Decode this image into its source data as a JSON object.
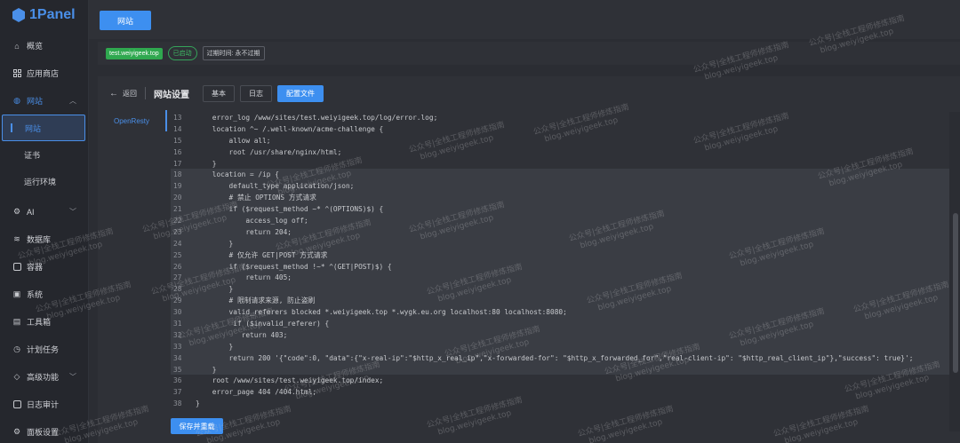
{
  "app": {
    "name": "1Panel",
    "brand_color": "#4a8fe8"
  },
  "sidebar": {
    "items": [
      {
        "label": "概览",
        "icon": "home-icon"
      },
      {
        "label": "应用商店",
        "icon": "grid-icon"
      },
      {
        "label": "网站",
        "icon": "globe-icon",
        "expanded": true,
        "children": [
          {
            "label": "网站",
            "active": true
          },
          {
            "label": "证书"
          },
          {
            "label": "运行环境"
          }
        ]
      },
      {
        "label": "AI",
        "icon": "robot-icon"
      },
      {
        "label": "数据库",
        "icon": "database-icon"
      },
      {
        "label": "容器",
        "icon": "container-icon"
      },
      {
        "label": "系统",
        "icon": "system-icon"
      },
      {
        "label": "工具箱",
        "icon": "toolbox-icon"
      },
      {
        "label": "计划任务",
        "icon": "clock-icon"
      },
      {
        "label": "高级功能",
        "icon": "diamond-icon"
      },
      {
        "label": "日志审计",
        "icon": "log-icon"
      },
      {
        "label": "面板设置",
        "icon": "gear-icon"
      }
    ]
  },
  "topbar": {
    "tab_label": "网站"
  },
  "infobar": {
    "site": "test.weiyigeek.top",
    "status": "已启动",
    "expire": "过期时间: 永不过期"
  },
  "panel": {
    "back_label": "返回",
    "title": "网站设置",
    "tabs": [
      "基本",
      "日志",
      "配置文件"
    ],
    "active_tab": "配置文件",
    "side_tab": "OpenResty",
    "save_label": "保存并重载"
  },
  "code": [
    {
      "n": "13",
      "t": "    error_log /www/sites/test.weiyigeek.top/log/error.log;"
    },
    {
      "n": "14",
      "t": "    location ^~ /.well-known/acme-challenge {"
    },
    {
      "n": "15",
      "t": "        allow all;"
    },
    {
      "n": "16",
      "t": "        root /usr/share/nginx/html;"
    },
    {
      "n": "17",
      "t": "    }"
    },
    {
      "n": "18",
      "t": "    location = /ip {",
      "hl": true
    },
    {
      "n": "19",
      "t": "        default_type application/json;",
      "hl": true
    },
    {
      "n": "20",
      "t": "        # 禁止 OPTIONS 方式请求",
      "hl": true
    },
    {
      "n": "21",
      "t": "        if ($request_method ~* ^(OPTIONS)$) {",
      "hl": true
    },
    {
      "n": "22",
      "t": "            access_log off;",
      "hl": true
    },
    {
      "n": "23",
      "t": "            return 204;",
      "hl": true
    },
    {
      "n": "24",
      "t": "        }",
      "hl": true
    },
    {
      "n": "25",
      "t": "        # 仅允许 GET|POST 方式请求",
      "hl": true
    },
    {
      "n": "26",
      "t": "        if ($request_method !~* ^(GET|POST)$) {",
      "hl": true
    },
    {
      "n": "27",
      "t": "            return 405;",
      "hl": true
    },
    {
      "n": "28",
      "t": "        }",
      "hl": true
    },
    {
      "n": "29",
      "t": "        # 限制请求来源, 防止盗刷",
      "hl": true
    },
    {
      "n": "30",
      "t": "        valid_referers blocked *.weiyigeek.top *.wygk.eu.org localhost:80 localhost:8080;",
      "hl": true
    },
    {
      "n": "31",
      "t": "         if ($invalid_referer) {",
      "hl": true
    },
    {
      "n": "32",
      "t": "           return 403;",
      "hl": true
    },
    {
      "n": "33",
      "t": "        }",
      "hl": true
    },
    {
      "n": "34",
      "t": "        return 200 '{\"code\":0, \"data\":{\"x-real-ip\":\"$http_x_real_ip\",\"x-forwarded-for\": \"$http_x_forwarded_for\",\"real-client-ip\": \"$http_real_client_ip\"},\"success\": true}';",
      "hl": true
    },
    {
      "n": "35",
      "t": "    }",
      "hl": true
    },
    {
      "n": "36",
      "t": "    root /www/sites/test.weiyigeek.top/index;"
    },
    {
      "n": "37",
      "t": "    error_page 404 /404.html;"
    },
    {
      "n": "38",
      "t": "}"
    }
  ],
  "watermark": {
    "line1": "公众号|全栈工程师修炼指南",
    "line2": "blog.weiyigeek.top"
  }
}
